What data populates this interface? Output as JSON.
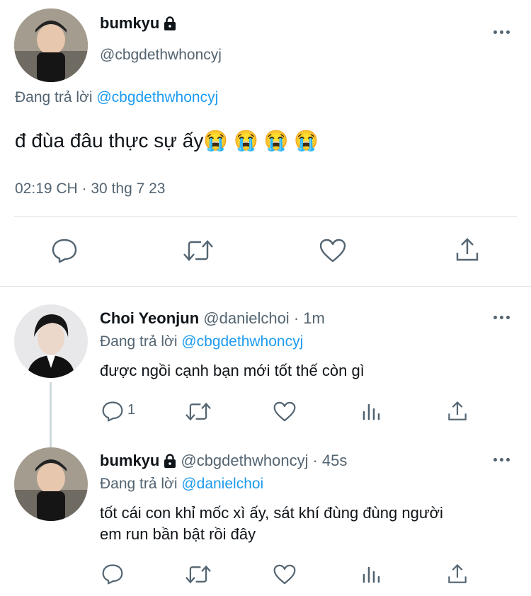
{
  "main_tweet": {
    "display_name": "bumkyu",
    "handle": "@cbgdethwhoncyj",
    "replying_to_label": "Đang trả lời",
    "replying_to_handle": "@cbgdethwhoncyj",
    "text": "đ đùa đâu thực sự ấy😭 😭 😭 😭",
    "timestamp": "02:19 CH · 30 thg 7 23",
    "locked": true
  },
  "replies": [
    {
      "display_name": "Choi Yeonjun",
      "handle": "@danielchoi",
      "time": "· 1m",
      "replying_to_label": "Đang trả lời",
      "replying_to_handle": "@cbgdethwhoncyj",
      "text_lines": [
        "được ngồi cạnh bạn mới tốt thế còn gì"
      ],
      "reply_count": "1"
    },
    {
      "display_name": "bumkyu",
      "handle": "@cbgdethwhoncyj",
      "time": "· 45s",
      "replying_to_label": "Đang trả lời",
      "replying_to_handle": "@danielchoi",
      "text_lines": [
        "tốt cái con khỉ mốc xì ấy, sát khí đùng đùng người",
        "em run bần bật rồi đây"
      ],
      "locked": true
    }
  ],
  "colors": {
    "accent": "#1d9bf0",
    "muted": "#536471",
    "text": "#0f1419"
  },
  "icons": [
    "more-icon",
    "lock-icon",
    "reply-icon",
    "retweet-icon",
    "like-icon",
    "views-icon",
    "share-icon"
  ]
}
